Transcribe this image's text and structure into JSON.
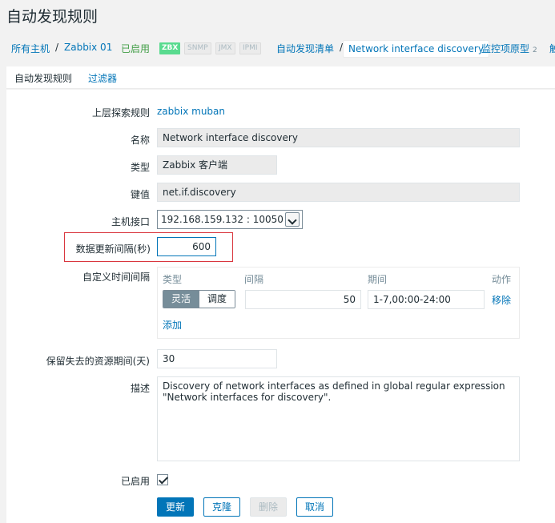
{
  "page_title": "自动发现规则",
  "breadcrumbs": {
    "all_hosts": "所有主机",
    "sep1": "/",
    "host": "Zabbix 01",
    "status": "已启用",
    "tags": [
      "ZBX",
      "SNMP",
      "JMX",
      "IPMI"
    ],
    "discovery_list": "自动发现清单",
    "sep2": "/",
    "current": "Network interface discovery",
    "item_prototypes": "监控项原型",
    "item_prototypes_count": "2",
    "trigger_prototypes_cut": "触"
  },
  "tabs": [
    {
      "label": "自动发现规则"
    },
    {
      "label": "过滤器"
    }
  ],
  "form": {
    "parent_label": "上层探索规则",
    "parent_value": "zabbix muban",
    "name_label": "名称",
    "name_value": "Network interface discovery",
    "type_label": "类型",
    "type_value": "Zabbix 客户端",
    "key_label": "键值",
    "key_value": "net.if.discovery",
    "interface_label": "主机接口",
    "interface_value": "192.168.159.132 : 10050",
    "interval_label": "数据更新间隔(秒)",
    "interval_value": "600",
    "custom_label": "自定义时间间隔",
    "custom_headers": {
      "type": "类型",
      "interval": "间隔",
      "period": "期间",
      "action": "动作"
    },
    "custom_row": {
      "flexible": "灵活",
      "scheduling": "调度",
      "interval": "50",
      "period": "1-7,00:00-24:00",
      "remove": "移除"
    },
    "add_link": "添加",
    "keep_lost_label": "保留失去的资源期间(天)",
    "keep_lost_value": "30",
    "description_label": "描述",
    "description_value": "Discovery of network interfaces as defined in global regular expression \"Network interfaces for discovery\".",
    "enabled_label": "已启用",
    "enabled": true
  },
  "buttons": {
    "update": "更新",
    "clone": "克隆",
    "delete": "删除",
    "cancel": "取消"
  },
  "colors": {
    "accent": "#0275b8",
    "enabled_green": "#429e47",
    "highlight_red": "#d9363e"
  }
}
